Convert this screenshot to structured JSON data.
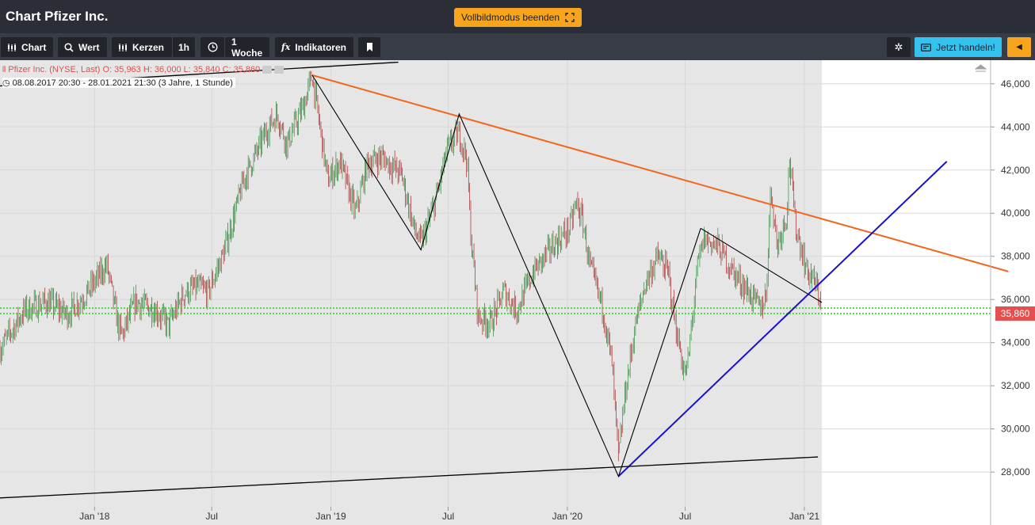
{
  "window": {
    "title": "Chart Pfizer Inc.",
    "fullscreen_label": "Vollbildmodus beenden"
  },
  "toolbar": {
    "chart_label": "Chart",
    "search_label": "Wert",
    "candles_label": "Kerzen",
    "interval_label": "1h",
    "range_label": "1 Woche",
    "indicators_label": "Indikatoren",
    "trade_label": "Jetzt handeln!"
  },
  "legend": {
    "series": "Pfizer Inc. (NYSE, Last)",
    "open": "O: 35,963",
    "high": "H: 36,000",
    "low": "L: 35,840",
    "close": "C: 35,860",
    "period": "08.08.2017 20:30 - 28.01.2021 21:30",
    "period_note": "(3 Jahre, 1 Stunde)"
  },
  "price_badge": "35,860",
  "colors": {
    "candle_up": "#2e8b3b",
    "candle_down": "#a52a2a",
    "trendline_orange": "#f2661e",
    "trendline_blue": "#1a10d0",
    "support_green": "#22dd22",
    "badge_red": "#e54f4f",
    "accent_orange": "#f8a51d",
    "accent_cyan": "#33c3ee"
  },
  "chart_data": {
    "type": "candlestick",
    "x_range": [
      "2017-08-08",
      "2021-01-28"
    ],
    "y_range": [
      26.5,
      46.8
    ],
    "y_ticks": [
      28,
      30,
      32,
      34,
      36,
      38,
      40,
      42,
      44,
      46
    ],
    "y_tick_labels": [
      "28,000",
      "30,000",
      "32,000",
      "34,000",
      "36,000",
      "38,000",
      "40,000",
      "42,000",
      "44,000",
      "46,000"
    ],
    "x_ticks": [
      {
        "date": "2018-01-01",
        "label": "Jan '18"
      },
      {
        "date": "2018-07-01",
        "label": "Jul"
      },
      {
        "date": "2019-01-01",
        "label": "Jan '19"
      },
      {
        "date": "2019-07-01",
        "label": "Jul"
      },
      {
        "date": "2020-01-01",
        "label": "Jan '20"
      },
      {
        "date": "2020-07-01",
        "label": "Jul"
      },
      {
        "date": "2021-01-01",
        "label": "Jan '21"
      }
    ],
    "price_path": [
      [
        "2017-08-08",
        33.7
      ],
      [
        "2017-09-15",
        35.5
      ],
      [
        "2017-10-20",
        35.9
      ],
      [
        "2017-11-20",
        35.3
      ],
      [
        "2017-12-20",
        36.3
      ],
      [
        "2018-01-20",
        37.6
      ],
      [
        "2018-02-05",
        35.0
      ],
      [
        "2018-02-12",
        34.3
      ],
      [
        "2018-03-05",
        35.9
      ],
      [
        "2018-04-05",
        35.5
      ],
      [
        "2018-04-25",
        34.8
      ],
      [
        "2018-05-20",
        36.3
      ],
      [
        "2018-06-10",
        36.6
      ],
      [
        "2018-06-25",
        36.3
      ],
      [
        "2018-07-20",
        38.2
      ],
      [
        "2018-08-20",
        41.6
      ],
      [
        "2018-09-25",
        43.9
      ],
      [
        "2018-10-10",
        44.6
      ],
      [
        "2018-10-25",
        43.2
      ],
      [
        "2018-11-20",
        45.0
      ],
      [
        "2018-12-03",
        46.4
      ],
      [
        "2018-12-15",
        44.0
      ],
      [
        "2018-12-27",
        41.5
      ],
      [
        "2019-01-15",
        42.4
      ],
      [
        "2019-02-08",
        40.0
      ],
      [
        "2019-02-26",
        42.3
      ],
      [
        "2019-03-20",
        42.6
      ],
      [
        "2019-04-20",
        41.8
      ],
      [
        "2019-05-10",
        39.2
      ],
      [
        "2019-05-20",
        38.6
      ],
      [
        "2019-06-10",
        40.4
      ],
      [
        "2019-06-30",
        43.0
      ],
      [
        "2019-07-18",
        43.7
      ],
      [
        "2019-07-30",
        42.5
      ],
      [
        "2019-08-05",
        39.0
      ],
      [
        "2019-08-16",
        35.2
      ],
      [
        "2019-09-05",
        34.9
      ],
      [
        "2019-09-25",
        36.4
      ],
      [
        "2019-10-15",
        35.5
      ],
      [
        "2019-11-10",
        37.3
      ],
      [
        "2019-12-10",
        38.5
      ],
      [
        "2020-01-05",
        39.3
      ],
      [
        "2020-01-15",
        40.5
      ],
      [
        "2020-01-25",
        39.6
      ],
      [
        "2020-02-05",
        37.5
      ],
      [
        "2020-02-25",
        35.6
      ],
      [
        "2020-03-10",
        33.0
      ],
      [
        "2020-03-20",
        28.6
      ],
      [
        "2020-03-30",
        31.6
      ],
      [
        "2020-04-15",
        34.8
      ],
      [
        "2020-05-01",
        36.8
      ],
      [
        "2020-05-20",
        38.0
      ],
      [
        "2020-06-05",
        37.2
      ],
      [
        "2020-06-15",
        35.0
      ],
      [
        "2020-06-30",
        32.5
      ],
      [
        "2020-07-05",
        33.0
      ],
      [
        "2020-07-20",
        37.5
      ],
      [
        "2020-07-30",
        38.8
      ],
      [
        "2020-08-20",
        38.5
      ],
      [
        "2020-09-15",
        37.2
      ],
      [
        "2020-10-05",
        36.4
      ],
      [
        "2020-10-25",
        35.6
      ],
      [
        "2020-11-03",
        36.2
      ],
      [
        "2020-11-10",
        41.2
      ],
      [
        "2020-11-20",
        38.5
      ],
      [
        "2020-12-05",
        40.0
      ],
      [
        "2020-12-09",
        42.6
      ],
      [
        "2020-12-18",
        39.5
      ],
      [
        "2021-01-05",
        37.3
      ],
      [
        "2021-01-15",
        36.9
      ],
      [
        "2021-01-28",
        35.86
      ]
    ],
    "trendlines": [
      {
        "color": "#f2661e",
        "from": [
          "2018-12-03",
          46.4
        ],
        "to": [
          "2021-11-12",
          37.3
        ]
      },
      {
        "color": "#1a10d0",
        "from": [
          "2020-03-20",
          27.8
        ],
        "to": [
          "2021-08-09",
          42.4
        ]
      },
      {
        "color": "#000000",
        "from": [
          "2017-08-08",
          45.9
        ],
        "to": [
          "2019-04-15",
          47.0
        ]
      },
      {
        "color": "#000000",
        "from": [
          "2017-08-08",
          26.8
        ],
        "to": [
          "2021-01-22",
          28.7
        ]
      }
    ],
    "pattern_lines": [
      [
        [
          "2018-12-03",
          46.4
        ],
        [
          "2019-05-20",
          38.3
        ],
        [
          "2019-07-18",
          44.6
        ],
        [
          "2020-03-20",
          27.8
        ],
        [
          "2020-07-25",
          39.3
        ]
      ],
      [
        [
          "2020-07-25",
          39.3
        ],
        [
          "2021-01-28",
          35.86
        ]
      ]
    ],
    "support_lines": [
      35.6,
      35.35
    ],
    "shaded_range": [
      "2017-08-08",
      "2021-01-28"
    ],
    "last_price": 35.86
  }
}
